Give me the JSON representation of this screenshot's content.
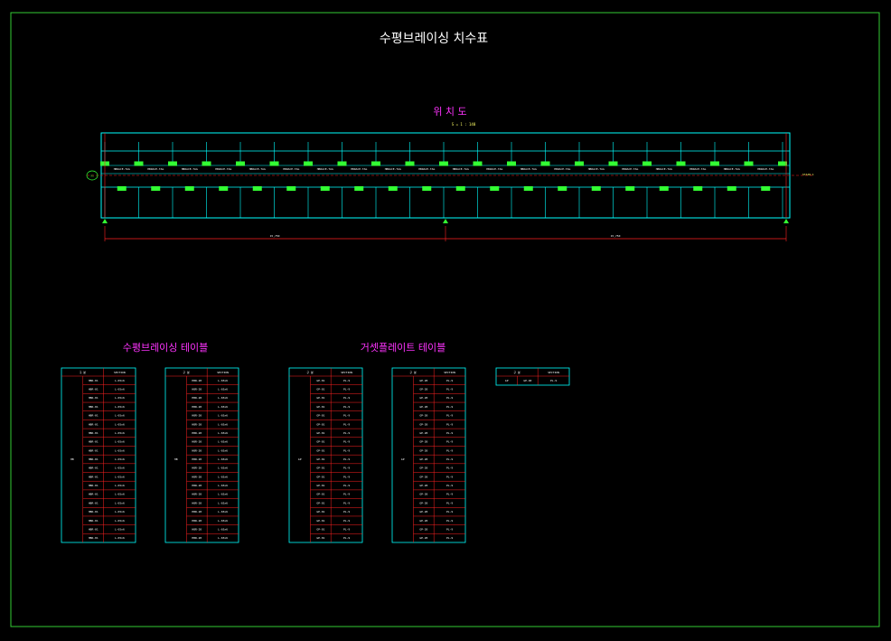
{
  "title": "수평브레이싱 치수표",
  "location_plan": {
    "title": "위 치 도",
    "scale": "S = 1 : 140",
    "grid_bubble": "X1",
    "right_label": "STAIR-1",
    "dim_left": "15,750",
    "dim_right": "15,750",
    "bay_count": 20,
    "tag_text": "HBRACE-TAG"
  },
  "section_titles": {
    "bracing": "수평브레이싱 테이블",
    "gusset": "거셋플레이트 테이블"
  },
  "tables": [
    {
      "header": [
        "구 분",
        "SECTION"
      ],
      "rows": 19,
      "group": "HB",
      "cell_a": "HBR-01",
      "cell_b": "L-65x6"
    },
    {
      "header": [
        "구 분",
        "SECTION"
      ],
      "rows": 19,
      "group": "HB",
      "cell_a": "HBR-20",
      "cell_b": "L-65x6"
    },
    {
      "header": [
        "구 분",
        "SECTION"
      ],
      "rows": 19,
      "group": "GP",
      "cell_a": "GP-01",
      "cell_b": "PL-9"
    },
    {
      "header": [
        "구 분",
        "SECTION"
      ],
      "rows": 19,
      "group": "GP",
      "cell_a": "GP-20",
      "cell_b": "PL-9"
    },
    {
      "header": [
        "구 분",
        "SECTION"
      ],
      "rows": 1,
      "group": "GP",
      "cell_a": "GP-40",
      "cell_b": "PL-9"
    }
  ],
  "colors": {
    "border": "#33cc33",
    "frame": "#00ffff",
    "dimension": "#ff2222",
    "label": "#ff33ff",
    "marker": "#33ff33"
  }
}
